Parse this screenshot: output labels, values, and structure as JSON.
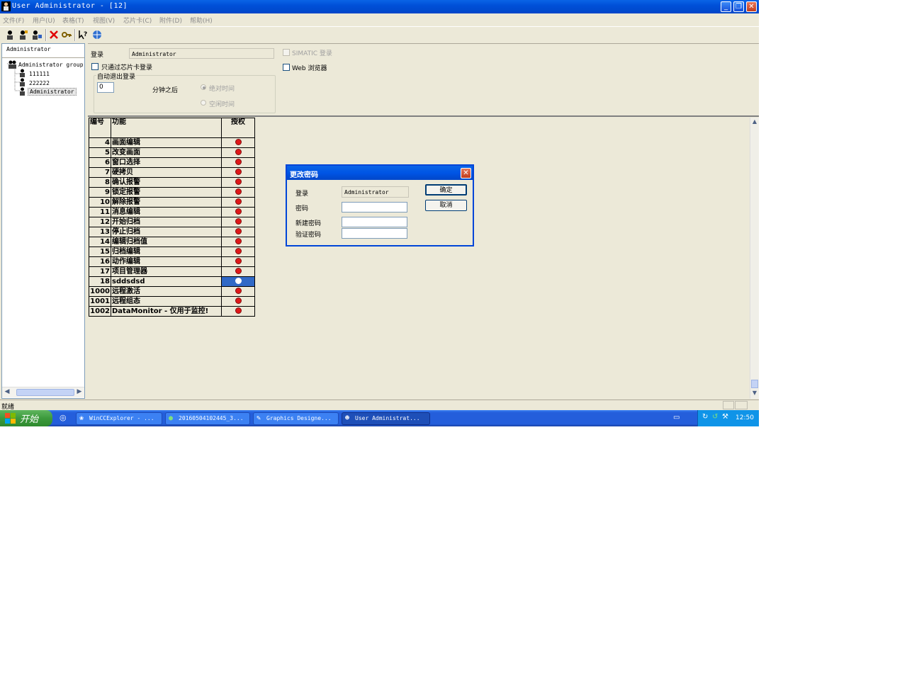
{
  "window": {
    "title": "User Administrator - [12]",
    "minimize": "_",
    "restore": "❐",
    "close": "✕"
  },
  "menu": [
    "文件(F)",
    "用户(U)",
    "表格(T)",
    "视图(V)",
    "芯片卡(C)",
    "附件(D)",
    "帮助(H)"
  ],
  "tree": {
    "header": "Administrator",
    "group": "Administrator group",
    "users": [
      "111111",
      "222222",
      "Administrator"
    ]
  },
  "form": {
    "login_label": "登录",
    "login_value": "Administrator",
    "chipcard_only": "只通过芯片卡登录",
    "auto_logout_title": "自动退出登录",
    "minutes_value": "0",
    "minutes_after": "分钟之后",
    "absolute_time": "绝对时间",
    "idle_time": "空闲时间",
    "simatic_login": "SIMATIC 登录",
    "web_browser": "Web 浏览器"
  },
  "table": {
    "headers": {
      "number": "编号",
      "function": "功能",
      "authorization": "授权"
    },
    "rows": [
      {
        "number": "4",
        "function": "画面编辑"
      },
      {
        "number": "5",
        "function": "改变画面"
      },
      {
        "number": "6",
        "function": "窗口选择"
      },
      {
        "number": "7",
        "function": "硬拷贝"
      },
      {
        "number": "8",
        "function": "确认报警"
      },
      {
        "number": "9",
        "function": "锁定报警"
      },
      {
        "number": "10",
        "function": "解除报警"
      },
      {
        "number": "11",
        "function": "消息编辑"
      },
      {
        "number": "12",
        "function": "开始归档"
      },
      {
        "number": "13",
        "function": "停止归档"
      },
      {
        "number": "14",
        "function": "编辑归档值"
      },
      {
        "number": "15",
        "function": "归档编辑"
      },
      {
        "number": "16",
        "function": "动作编辑"
      },
      {
        "number": "17",
        "function": "项目管理器"
      },
      {
        "number": "18",
        "function": "sddsdsd"
      },
      {
        "number": "1000",
        "function": "远程激活"
      },
      {
        "number": "1001",
        "function": "远程组态"
      },
      {
        "number": "1002",
        "function": "DataMonitor - 仅用于监控!"
      }
    ],
    "selected_row": 14
  },
  "dialog": {
    "title": "更改密码",
    "login_label": "登录",
    "login_value": "Administrator",
    "password_label": "密码",
    "new_password_label": "新建密码",
    "verify_password_label": "验证密码",
    "ok": "确定",
    "cancel": "取消",
    "close": "✕"
  },
  "status": {
    "text": "就绪"
  },
  "taskbar": {
    "start": "开始",
    "tasks": [
      "WinCCExplorer - ...",
      "20160504102445_3...",
      "Graphics Designe...",
      "User Administrat..."
    ],
    "clock": "12:50"
  }
}
